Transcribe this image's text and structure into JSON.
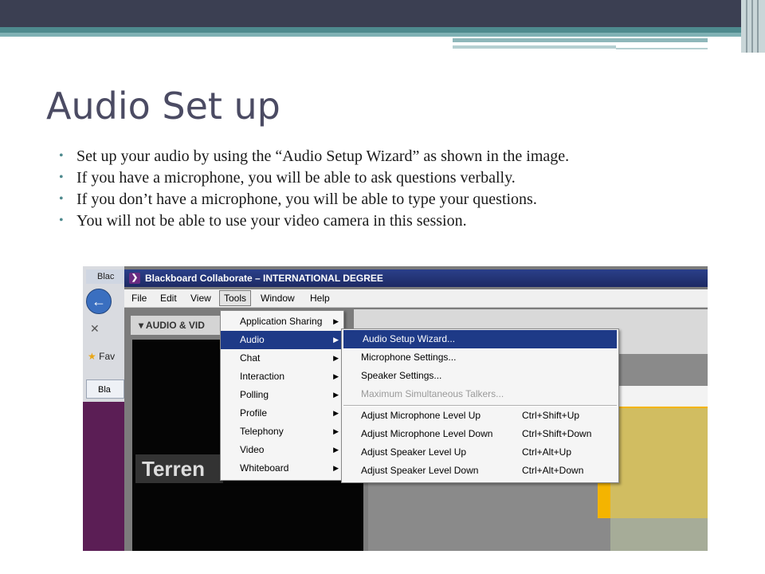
{
  "slide": {
    "title": "Audio Set up",
    "bullets": [
      "Set up your audio by using the “Audio Setup Wizard” as shown in the image.",
      "If you have a microphone, you will be able to ask questions verbally.",
      "If you don’t have a microphone, you will be able to type your questions.",
      "You will not be able to use your video camera in this session."
    ],
    "colors": {
      "title": "#4b4b63",
      "accent": "#4e8a8e",
      "header": "#3b3f52"
    }
  },
  "screenshot": {
    "ie": {
      "tab_label": "Blac",
      "favorites_label": "Fav",
      "page_label": "Bla"
    },
    "window_title": "Blackboard Collaborate – INTERNATIONAL DEGREE",
    "menubar": [
      "File",
      "Edit",
      "View",
      "Tools",
      "Window",
      "Help"
    ],
    "panel_header": "AUDIO & VID",
    "video_name": "Terren",
    "tools_menu": [
      {
        "label": "Application Sharing",
        "submenu": true
      },
      {
        "label": "Audio",
        "submenu": true,
        "selected": true
      },
      {
        "label": "Chat",
        "submenu": true
      },
      {
        "label": "Interaction",
        "submenu": true
      },
      {
        "label": "Polling",
        "submenu": true
      },
      {
        "label": "Profile",
        "submenu": true
      },
      {
        "label": "Telephony",
        "submenu": true
      },
      {
        "label": "Video",
        "submenu": true
      },
      {
        "label": "Whiteboard",
        "submenu": true
      }
    ],
    "audio_menu": {
      "group1": [
        {
          "label": "Audio Setup Wizard...",
          "selected": true
        },
        {
          "label": "Microphone Settings..."
        },
        {
          "label": "Speaker Settings..."
        },
        {
          "label": "Maximum Simultaneous Talkers...",
          "disabled": true
        }
      ],
      "group2": [
        {
          "label": "Adjust Microphone Level Up",
          "shortcut": "Ctrl+Shift+Up"
        },
        {
          "label": "Adjust Microphone Level Down",
          "shortcut": "Ctrl+Shift+Down"
        },
        {
          "label": "Adjust Speaker Level Up",
          "shortcut": "Ctrl+Alt+Up"
        },
        {
          "label": "Adjust Speaker Level Down",
          "shortcut": "Ctrl+Alt+Down"
        }
      ]
    }
  }
}
